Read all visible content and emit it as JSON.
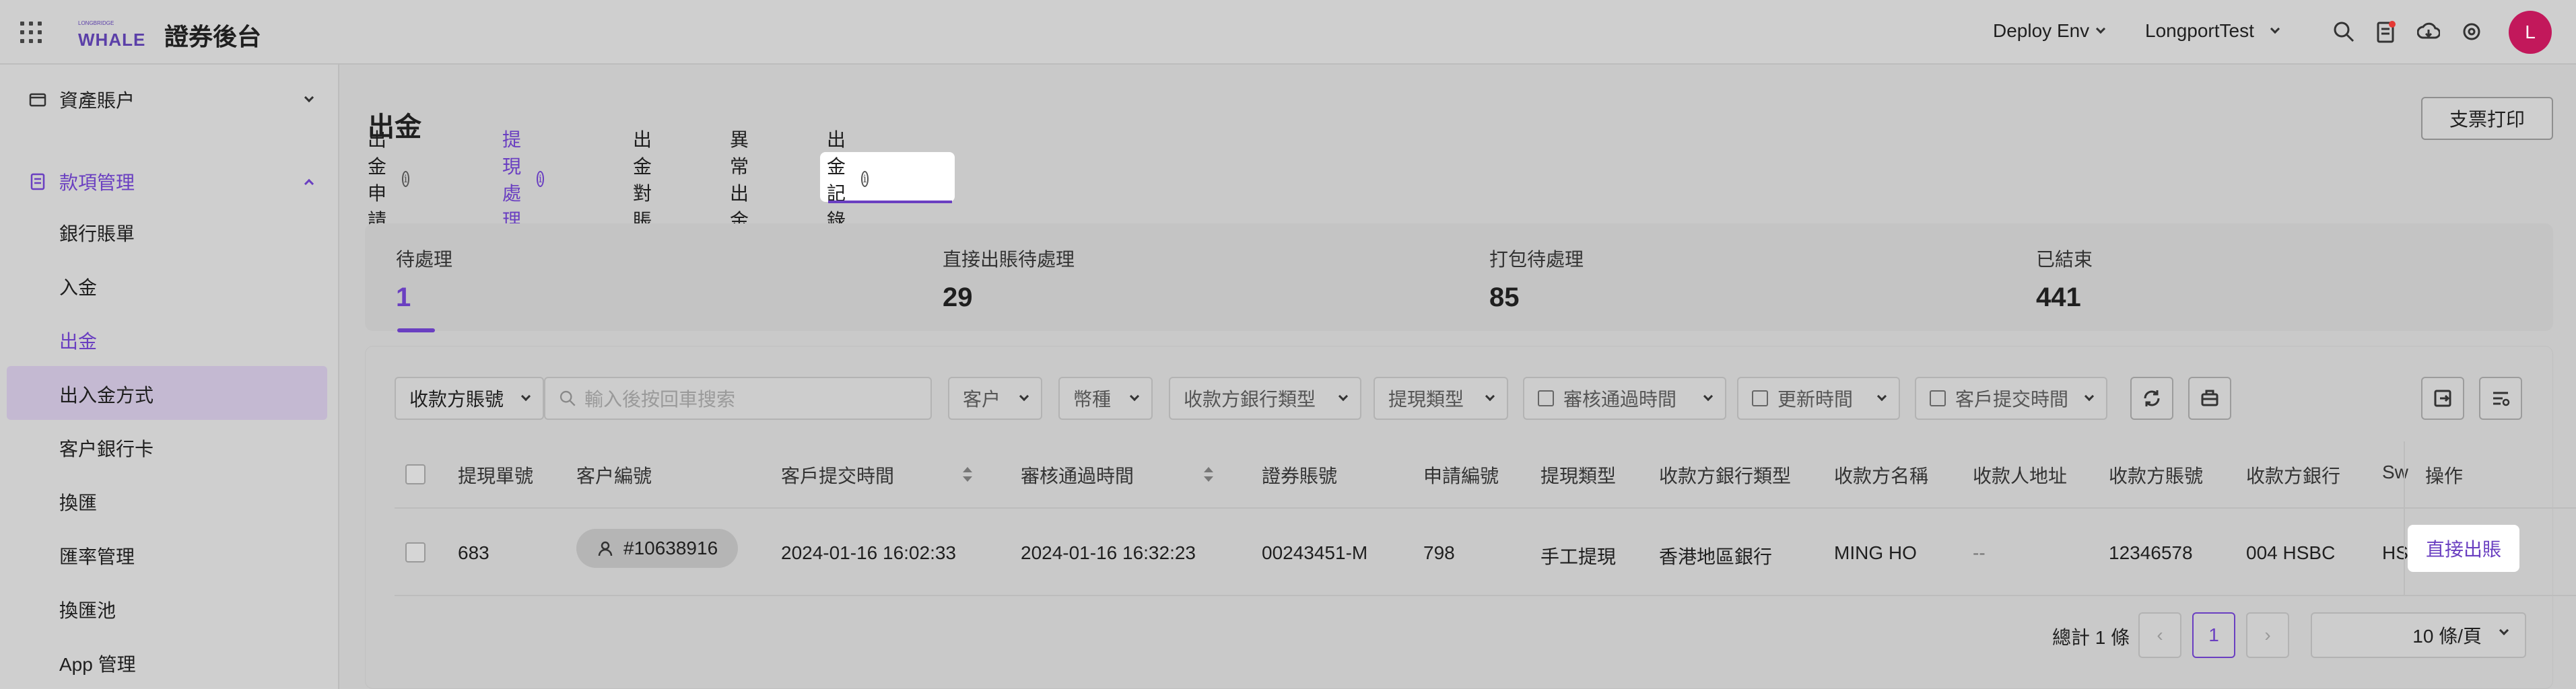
{
  "header": {
    "logo_small": "LONGBRIDGE",
    "logo_text": "WHALE",
    "app_title": "證券後台",
    "env_label": "Deploy Env",
    "account_label": "LongportTest",
    "avatar_initial": "L"
  },
  "sidebar": {
    "group_assets": "資產賬户",
    "group_payments": "款項管理",
    "items": [
      {
        "label": "銀行賬單"
      },
      {
        "label": "入金"
      },
      {
        "label": "出金"
      },
      {
        "label": "出入金方式"
      },
      {
        "label": "客户銀行卡"
      },
      {
        "label": "換匯"
      },
      {
        "label": "匯率管理"
      },
      {
        "label": "換匯池"
      },
      {
        "label": "App 管理"
      }
    ]
  },
  "main": {
    "title": "出金",
    "print_button": "支票打印",
    "tabs": [
      {
        "label": "出金申請"
      },
      {
        "label": "提現處理"
      },
      {
        "label": "出金對賬"
      },
      {
        "label": "異常出金"
      },
      {
        "label": "出金記錄"
      }
    ],
    "stats": [
      {
        "label": "待處理",
        "value": "1"
      },
      {
        "label": "直接出賬待處理",
        "value": "29"
      },
      {
        "label": "打包待處理",
        "value": "85"
      },
      {
        "label": "已結束",
        "value": "441"
      }
    ],
    "filters": {
      "account_type": "收款方賬號",
      "search_placeholder": "輸入後按回車搜索",
      "customer": "客户",
      "currency": "幣種",
      "bank_type": "收款方銀行類型",
      "withdraw_type": "提現類型",
      "approve_time": "審核通過時間",
      "update_time": "更新時間",
      "submit_time": "客戶提交時間"
    },
    "table": {
      "headers": [
        "提現單號",
        "客户編號",
        "客戶提交時間",
        "審核通過時間",
        "證券賬號",
        "申請編號",
        "提現類型",
        "收款方銀行類型",
        "收款方名稱",
        "收款人地址",
        "收款方賬號",
        "收款方銀行",
        "Sw",
        "操作"
      ],
      "rows": [
        {
          "id": "683",
          "customer": "#10638916",
          "submit_time": "2024-01-16 16:02:33",
          "approve_time": "2024-01-16 16:32:23",
          "securities_account": "00243451-M",
          "apply_no": "798",
          "withdraw_type": "手工提現",
          "bank_type": "香港地區銀行",
          "payee_name": "MING HO",
          "payee_address": "--",
          "payee_account": "12346578",
          "payee_bank": "004 HSBC",
          "swift": "HS",
          "action": "直接出賬"
        }
      ]
    },
    "pagination": {
      "total": "總計 1 條",
      "current": "1",
      "page_size": "10 條/頁"
    }
  },
  "colors": {
    "accent": "#6a3fc1",
    "avatar": "#c2185b"
  }
}
